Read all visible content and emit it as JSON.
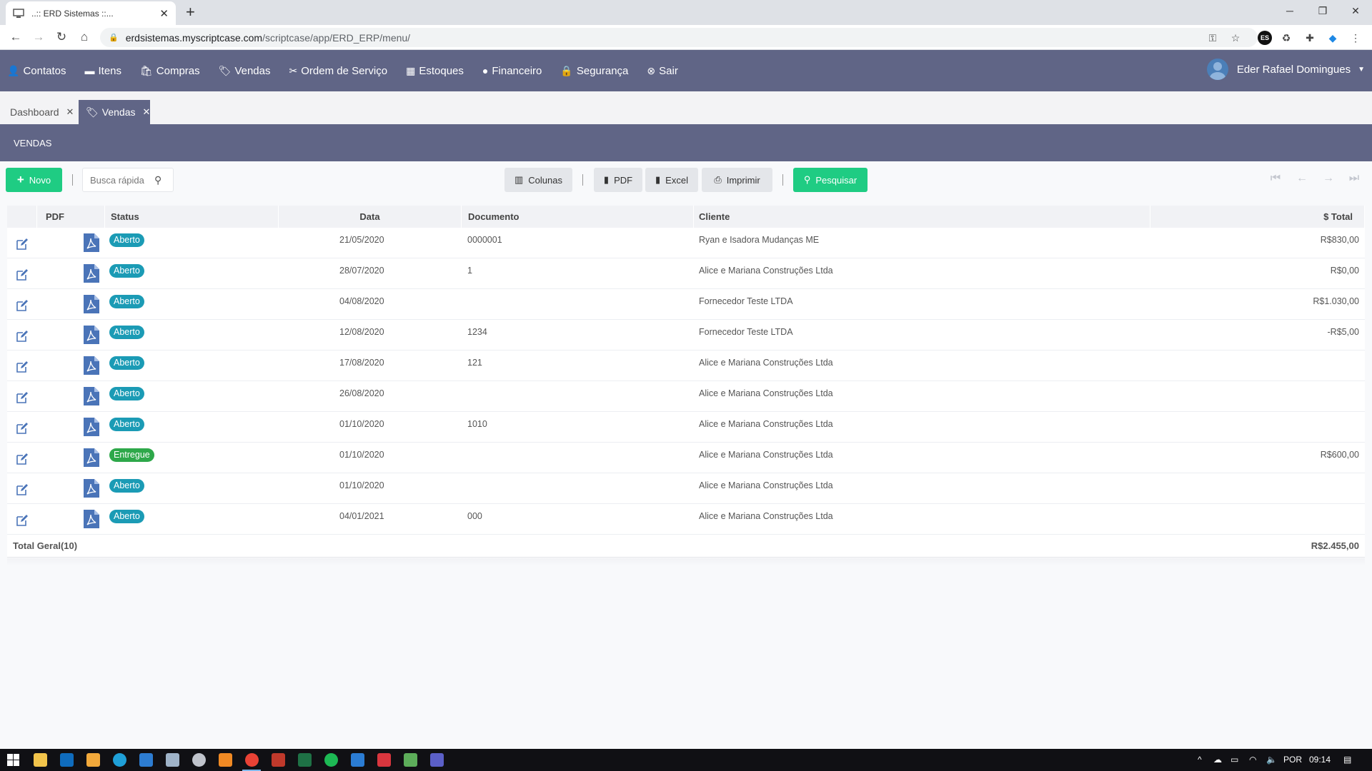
{
  "browser": {
    "tab_title": "..:: ERD Sistemas ::...",
    "url_domain": "erdsistemas.myscriptcase.com",
    "url_path": "/scriptcase/app/ERD_ERP/menu/"
  },
  "navbar": {
    "items": [
      {
        "label": "Contatos",
        "icon": "user-icon"
      },
      {
        "label": "Itens",
        "icon": "book-icon"
      },
      {
        "label": "Compras",
        "icon": "shopping-bag-icon"
      },
      {
        "label": "Vendas",
        "icon": "tags-icon"
      },
      {
        "label": "Ordem de Serviço",
        "icon": "tools-icon"
      },
      {
        "label": "Estoques",
        "icon": "boxes-icon"
      },
      {
        "label": "Financeiro",
        "icon": "money-icon"
      },
      {
        "label": "Segurança",
        "icon": "lock-icon"
      },
      {
        "label": "Sair",
        "icon": "close-circle-icon"
      }
    ],
    "user_name": "Eder Rafael Domingues"
  },
  "app_tabs": {
    "dashboard": "Dashboard",
    "vendas": "Vendas"
  },
  "section_title": "VENDAS",
  "toolbar": {
    "novo": "Novo",
    "search_placeholder": "Busca rápida",
    "colunas": "Colunas",
    "pdf": "PDF",
    "excel": "Excel",
    "imprimir": "Imprimir",
    "pesquisar": "Pesquisar"
  },
  "table": {
    "headers": {
      "pdf": "PDF",
      "status": "Status",
      "data": "Data",
      "documento": "Documento",
      "cliente": "Cliente",
      "total": "$ Total"
    },
    "rows": [
      {
        "status": "Aberto",
        "data": "21/05/2020",
        "documento": "0000001",
        "cliente": "Ryan e Isadora Mudanças ME",
        "total": "R$830,00"
      },
      {
        "status": "Aberto",
        "data": "28/07/2020",
        "documento": "1",
        "cliente": "Alice e Mariana Construções Ltda",
        "total": "R$0,00"
      },
      {
        "status": "Aberto",
        "data": "04/08/2020",
        "documento": "",
        "cliente": "Fornecedor Teste LTDA",
        "total": "R$1.030,00"
      },
      {
        "status": "Aberto",
        "data": "12/08/2020",
        "documento": "1234",
        "cliente": "Fornecedor Teste LTDA",
        "total": "-R$5,00"
      },
      {
        "status": "Aberto",
        "data": "17/08/2020",
        "documento": "121",
        "cliente": "Alice e Mariana Construções Ltda",
        "total": ""
      },
      {
        "status": "Aberto",
        "data": "26/08/2020",
        "documento": "",
        "cliente": "Alice e Mariana Construções Ltda",
        "total": ""
      },
      {
        "status": "Aberto",
        "data": "01/10/2020",
        "documento": "1010",
        "cliente": "Alice e Mariana Construções Ltda",
        "total": ""
      },
      {
        "status": "Entregue",
        "data": "01/10/2020",
        "documento": "",
        "cliente": "Alice e Mariana Construções Ltda",
        "total": "R$600,00"
      },
      {
        "status": "Aberto",
        "data": "01/10/2020",
        "documento": "",
        "cliente": "Alice e Mariana Construções Ltda",
        "total": ""
      },
      {
        "status": "Aberto",
        "data": "04/01/2021",
        "documento": "000",
        "cliente": "Alice e Mariana Construções Ltda",
        "total": ""
      }
    ],
    "footer_label": "Total Geral(10)",
    "footer_total": "R$2.455,00"
  },
  "colors": {
    "navbar": "#606586",
    "accent_green": "#1fcc83",
    "badge_aberto": "#1b9bb5",
    "badge_entregue": "#2ea84a",
    "pdf_icon": "#4a74b8"
  },
  "taskbar": {
    "language": "POR",
    "time": "09:14"
  }
}
